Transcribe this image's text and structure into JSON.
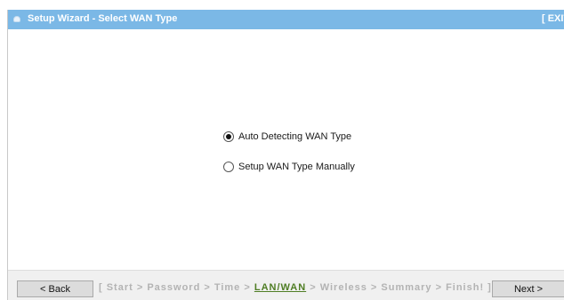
{
  "header": {
    "title": "Setup Wizard - Select WAN Type",
    "exit_label": "[ EXIT",
    "icon": "bulb-icon"
  },
  "options": [
    {
      "label": "Auto Detecting WAN Type",
      "selected": true
    },
    {
      "label": "Setup WAN Type Manually",
      "selected": false
    }
  ],
  "footer": {
    "back_label": "< Back",
    "next_label": "Next >",
    "steps_prefix": "[ Start > Password > Time > ",
    "current_step": "LAN/WAN",
    "steps_suffix": " > Wireless > Summary > Finish! ]"
  },
  "colors": {
    "header_bg": "#7bb8e6",
    "current_step": "#4f7d24",
    "inactive_step": "#b3b3b3",
    "footer_bg": "#f0f0f0"
  }
}
